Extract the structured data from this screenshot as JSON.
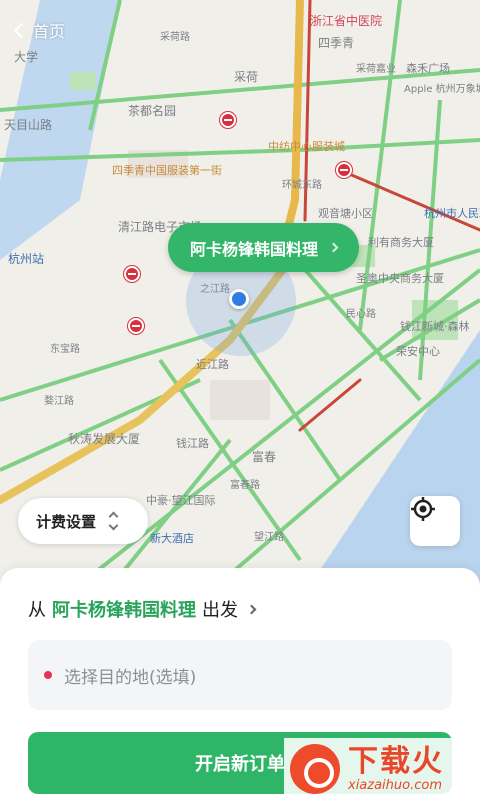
{
  "header": {
    "back_label": "首页"
  },
  "map": {
    "labels": {
      "l1": "大学",
      "l2": "天目山路",
      "l3": "杭州站",
      "l4": "茶都名园",
      "l5": "采荷",
      "l6": "四季青",
      "l7": "浙江省中医院",
      "l8": "采荷路",
      "l9": "中纺中心服装城",
      "l10": "四季青中国服装第一街",
      "l11": "清江路电子市场",
      "l12": "观音塘小区",
      "l13": "杭州市人民政府",
      "l14": "利有商务大厦",
      "l15": "圣奥中央商务大厦",
      "l16": "钱江新城·森林",
      "l17": "荣安中心",
      "l18": "近江路",
      "l19": "秋涛发展大厦",
      "l20": "钱江路",
      "l21": "富春",
      "l22": "中豪·望江国际",
      "l23": "新大酒店",
      "l24": "森禾广场",
      "l25": "Apple 杭州万象城",
      "l26": "采荷嘉业",
      "l27": "环城东路",
      "l28": "之江路",
      "l29": "富春路",
      "l30": "民心路",
      "l31": "东宝路",
      "l32": "婺江路",
      "l33": "望江路"
    }
  },
  "bubble": {
    "place_name": "阿卡杨锋韩国料理"
  },
  "fee_button": {
    "label": "计费设置"
  },
  "sheet": {
    "from_prefix": "从",
    "from_place": "阿卡杨锋韩国料理",
    "from_suffix": "出发",
    "destination_placeholder": "选择目的地(选填)",
    "start_button": "开启新订单"
  },
  "watermark": {
    "brand": "下载火",
    "domain": "xiazaihuo.com"
  },
  "colors": {
    "accent": "#2fb567",
    "location": "#2f7de2",
    "dest_dot": "#e8305c"
  }
}
